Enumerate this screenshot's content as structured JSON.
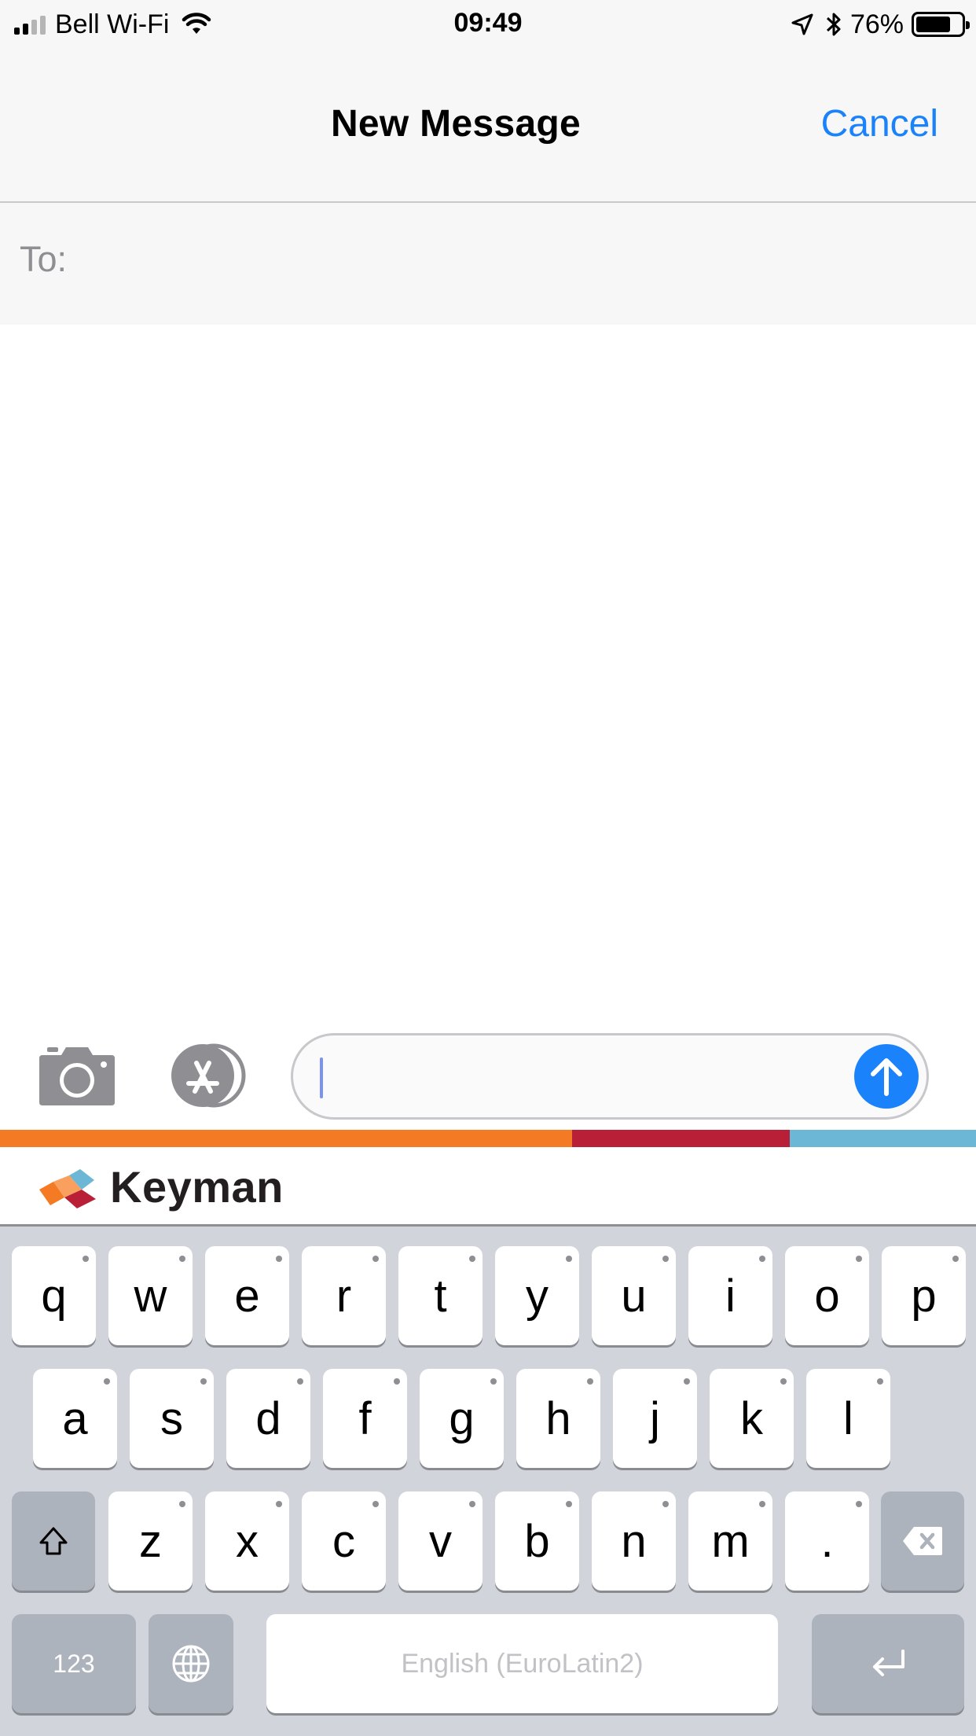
{
  "status_bar": {
    "carrier": "Bell Wi-Fi",
    "time": "09:49",
    "battery_percent": "76%",
    "battery_level": 0.76,
    "signal_bars_filled": 2,
    "icons": [
      "signal-icon",
      "wifi-icon",
      "location-arrow-icon",
      "bluetooth-icon",
      "battery-icon"
    ]
  },
  "nav": {
    "title": "New Message",
    "cancel": "Cancel"
  },
  "to_field": {
    "label": "To:",
    "value": ""
  },
  "composer": {
    "text_value": "",
    "buttons": [
      "camera-icon",
      "app-store-icon",
      "send-arrow-icon"
    ]
  },
  "keyman": {
    "brand_name": "Keyman",
    "strip_colors": [
      "#f47a24",
      "#b91f36",
      "#6bb7d5"
    ]
  },
  "keyboard": {
    "row1": [
      "q",
      "w",
      "e",
      "r",
      "t",
      "y",
      "u",
      "i",
      "o",
      "p"
    ],
    "row2": [
      "a",
      "s",
      "d",
      "f",
      "g",
      "h",
      "j",
      "k",
      "l"
    ],
    "row3": [
      "z",
      "x",
      "c",
      "v",
      "b",
      "n",
      "m",
      "."
    ],
    "numbers_label": "123",
    "space_label": "English (EuroLatin2)",
    "icons": [
      "shift-icon",
      "backspace-icon",
      "globe-icon",
      "return-icon"
    ]
  },
  "colors": {
    "accent_blue": "#1a82fb",
    "keyboard_bg": "#d1d5db",
    "modifier_key": "#adb3bc"
  }
}
